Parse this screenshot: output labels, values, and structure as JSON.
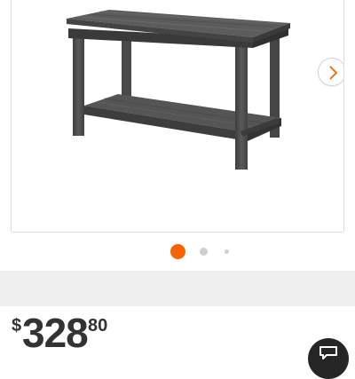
{
  "product": {
    "image_description_icon": "counter-height-table-image",
    "next_icon": "chevron-right-icon"
  },
  "carousel": {
    "active_color": "#f96302",
    "inactive_color": "#cfcfcf",
    "active_index": 0,
    "dot_count": 3
  },
  "price": {
    "currency": "$",
    "whole": "328",
    "cents": "80"
  },
  "chat": {
    "icon": "chat-icon"
  }
}
